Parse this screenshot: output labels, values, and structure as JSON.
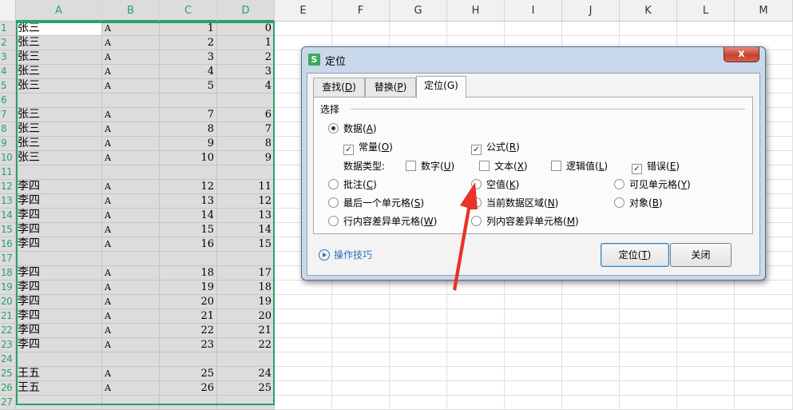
{
  "spreadsheet": {
    "columns": [
      "A",
      "B",
      "C",
      "D",
      "E",
      "F",
      "G",
      "H",
      "I",
      "J",
      "K",
      "L",
      "M"
    ],
    "rows": [
      {
        "n": "1",
        "a": "张三",
        "b": "A",
        "c": "1",
        "d": "0"
      },
      {
        "n": "2",
        "a": "张三",
        "b": "A",
        "c": "2",
        "d": "1"
      },
      {
        "n": "3",
        "a": "张三",
        "b": "A",
        "c": "3",
        "d": "2"
      },
      {
        "n": "4",
        "a": "张三",
        "b": "A",
        "c": "4",
        "d": "3"
      },
      {
        "n": "5",
        "a": "张三",
        "b": "A",
        "c": "5",
        "d": "4"
      },
      {
        "n": "6",
        "a": "",
        "b": "",
        "c": "",
        "d": ""
      },
      {
        "n": "7",
        "a": "张三",
        "b": "A",
        "c": "7",
        "d": "6"
      },
      {
        "n": "8",
        "a": "张三",
        "b": "A",
        "c": "8",
        "d": "7"
      },
      {
        "n": "9",
        "a": "张三",
        "b": "A",
        "c": "9",
        "d": "8"
      },
      {
        "n": "10",
        "a": "张三",
        "b": "A",
        "c": "10",
        "d": "9"
      },
      {
        "n": "11",
        "a": "",
        "b": "",
        "c": "",
        "d": ""
      },
      {
        "n": "12",
        "a": "李四",
        "b": "A",
        "c": "12",
        "d": "11"
      },
      {
        "n": "13",
        "a": "李四",
        "b": "A",
        "c": "13",
        "d": "12"
      },
      {
        "n": "14",
        "a": "李四",
        "b": "A",
        "c": "14",
        "d": "13"
      },
      {
        "n": "15",
        "a": "李四",
        "b": "A",
        "c": "15",
        "d": "14"
      },
      {
        "n": "16",
        "a": "李四",
        "b": "A",
        "c": "16",
        "d": "15"
      },
      {
        "n": "17",
        "a": "",
        "b": "",
        "c": "",
        "d": ""
      },
      {
        "n": "18",
        "a": "李四",
        "b": "A",
        "c": "18",
        "d": "17"
      },
      {
        "n": "19",
        "a": "李四",
        "b": "A",
        "c": "19",
        "d": "18"
      },
      {
        "n": "20",
        "a": "李四",
        "b": "A",
        "c": "20",
        "d": "19"
      },
      {
        "n": "21",
        "a": "李四",
        "b": "A",
        "c": "21",
        "d": "20"
      },
      {
        "n": "22",
        "a": "李四",
        "b": "A",
        "c": "22",
        "d": "21"
      },
      {
        "n": "23",
        "a": "李四",
        "b": "A",
        "c": "23",
        "d": "22"
      },
      {
        "n": "24",
        "a": "",
        "b": "",
        "c": "",
        "d": ""
      },
      {
        "n": "25",
        "a": "王五",
        "b": "A",
        "c": "25",
        "d": "24"
      },
      {
        "n": "26",
        "a": "王五",
        "b": "A",
        "c": "26",
        "d": "25"
      },
      {
        "n": "27",
        "a": "",
        "b": "",
        "c": "",
        "d": ""
      }
    ]
  },
  "dialog": {
    "icon_letter": "S",
    "title": "定位",
    "close": "x",
    "tabs": [
      {
        "label": "查找(",
        "key": "D",
        "suffix": ")"
      },
      {
        "label": "替换(",
        "key": "P",
        "suffix": ")"
      },
      {
        "label": "定位(G)"
      }
    ],
    "group_label": "选择",
    "data_option": {
      "label": "数据(",
      "key": "A",
      "suffix": ")"
    },
    "constant": {
      "label": "常量(",
      "key": "O",
      "suffix": ")"
    },
    "formula": {
      "label": "公式(",
      "key": "R",
      "suffix": ")"
    },
    "data_type_label": "数据类型:",
    "number": {
      "label": "数字(",
      "key": "U",
      "suffix": ")"
    },
    "text": {
      "label": "文本(",
      "key": "X",
      "suffix": ")"
    },
    "logical": {
      "label": "逻辑值(",
      "key": "L",
      "suffix": ")"
    },
    "error": {
      "label": "错误(",
      "key": "E",
      "suffix": ")"
    },
    "comment": {
      "label": "批注(",
      "key": "C",
      "suffix": ")"
    },
    "blank": {
      "label": "空值(",
      "key": "K",
      "suffix": ")"
    },
    "visible": {
      "label": "可见单元格(",
      "key": "Y",
      "suffix": ")"
    },
    "last_cell": {
      "label": "最后一个单元格(",
      "key": "S",
      "suffix": ")"
    },
    "current_region": {
      "label": "当前数据区域(",
      "key": "N",
      "suffix": ")"
    },
    "objects": {
      "label": "对象(",
      "key": "B",
      "suffix": ")"
    },
    "row_diff": {
      "label": "行内容差异单元格(",
      "key": "W",
      "suffix": ")"
    },
    "col_diff": {
      "label": "列内容差异单元格(",
      "key": "M",
      "suffix": ")"
    },
    "tips": "操作技巧",
    "ok": {
      "label": "定位(",
      "key": "T",
      "suffix": ")"
    },
    "cancel": "关闭"
  },
  "colors": {
    "selection": "#2aa166",
    "arrow": "#e8322a"
  }
}
